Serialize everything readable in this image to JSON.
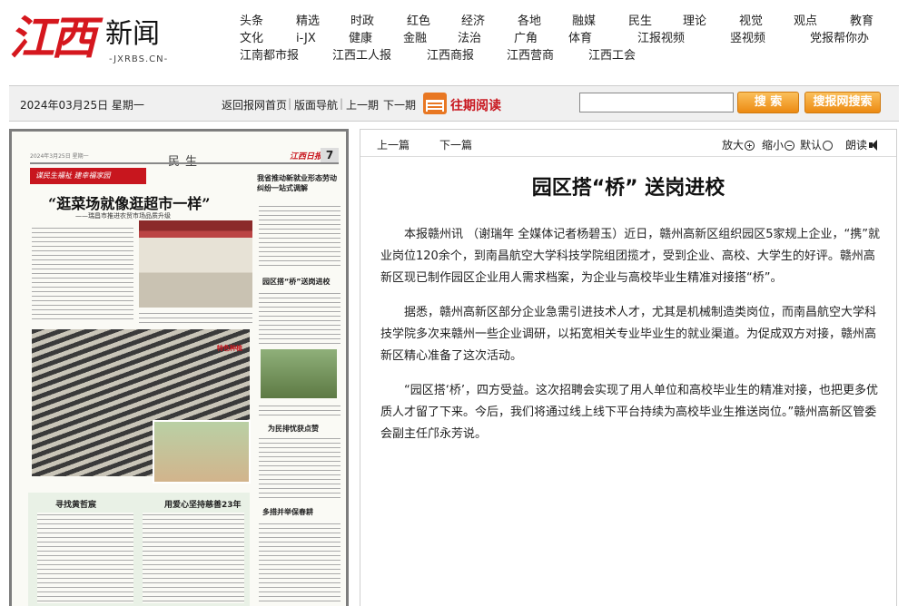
{
  "header": {
    "logo_mark": "江西",
    "logo_name": "新闻",
    "logo_sub": "-JXRBS.CN-",
    "nav_rows": [
      [
        "头条",
        "精选",
        "时政",
        "红色",
        "经济",
        "各地",
        "融媒",
        "民生",
        "理论",
        "视觉",
        "观点",
        "教育"
      ],
      [
        "文化",
        "i-JX",
        "健康",
        "金融",
        "法治",
        "广角",
        "体育",
        "江报视频",
        "竖视频",
        "党报帮你办"
      ],
      [
        "江南都市报",
        "江西工人报",
        "江西商报",
        "江西营商",
        "江西工会"
      ]
    ]
  },
  "toolbar": {
    "date": "2024年03月25日 星期一",
    "links": [
      "返回报网首页",
      "版面导航",
      "上一期",
      "下一期"
    ],
    "past_label": "往期阅读",
    "search_value": "",
    "search_button": "搜 索",
    "site_search_button": "搜报网搜索"
  },
  "paper": {
    "top_line": "2024年3月25日 星期一",
    "section": "民生",
    "logo": "江西日报",
    "page_no": "7",
    "ribbon": "谋民生福祉 建幸福家园",
    "headline": "“逛菜场就像逛超市一样”",
    "subhead": "——瑞昌市推进农贸市场品质升级",
    "right_h1": "我省推动新就业形态劳动纠纷一站式调解",
    "right_h2": "园区搭“桥”送岗进校",
    "tag": "特色种植",
    "right_h3": "为民排忧获点赞",
    "box_h1": "寻找黄哲宸",
    "box_h2": "用爱心坚持慈善23年",
    "right_h4": "多措并举保春耕"
  },
  "article": {
    "prev": "上一篇",
    "next": "下一篇",
    "zoom_in": "放大",
    "zoom_out": "缩小",
    "default": "默认",
    "read_aloud": "朗读",
    "title": "园区搭“桥” 送岗进校",
    "paragraphs": [
      "本报赣州讯 （谢瑞年 全媒体记者杨碧玉）近日，赣州高新区组织园区5家规上企业，“携”就业岗位120余个，到南昌航空大学科技学院组团揽才，受到企业、高校、大学生的好评。赣州高新区现已制作园区企业用人需求档案，为企业与高校毕业生精准对接搭“桥”。",
      "据悉，赣州高新区部分企业急需引进技术人才，尤其是机械制造类岗位，而南昌航空大学科技学院多次来赣州一些企业调研，以拓宽相关专业毕业生的就业渠道。为促成双方对接，赣州高新区精心准备了这次活动。",
      "“园区搭‘桥’，四方受益。这次招聘会实现了用人单位和高校毕业生的精准对接，也把更多优质人才留了下来。今后，我们将通过线上线下平台持续为高校毕业生推送岗位。”赣州高新区管委会副主任邝永芳说。"
    ]
  },
  "colors": {
    "brand_red": "#d5171e",
    "accent_orange": "#ec8a12"
  }
}
